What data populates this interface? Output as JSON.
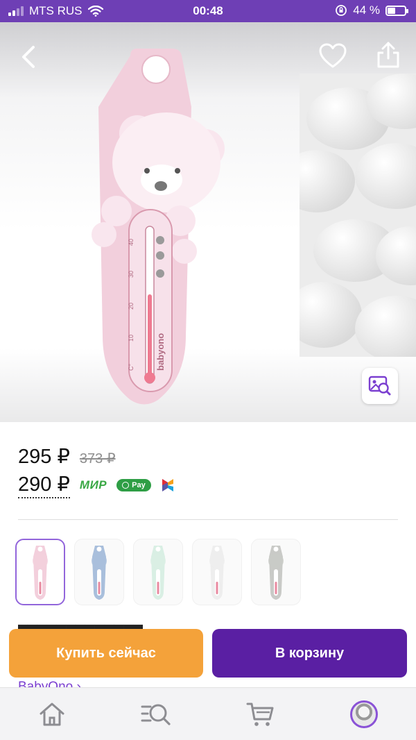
{
  "status_bar": {
    "carrier": "MTS RUS",
    "time": "00:48",
    "battery_percent": "44 %",
    "battery_level": 0.44
  },
  "gallery": {
    "icons": [
      "back-arrow-icon",
      "heart-icon",
      "share-icon",
      "image-search-icon"
    ],
    "product_print": {
      "scale_labels": [
        "40",
        "30",
        "20",
        "10",
        "C°"
      ],
      "brand": "babyono"
    }
  },
  "price": {
    "current": "295 ₽",
    "old": "373 ₽",
    "card_price": "290 ₽",
    "payment_badges": {
      "mir": "МИР",
      "sbp_pay": "Pay"
    }
  },
  "thumbnails": [
    {
      "variant": "pink bear",
      "selected": true,
      "color": "#f3cfdc"
    },
    {
      "variant": "blue koala",
      "selected": false,
      "color": "#a9bfdc"
    },
    {
      "variant": "mint",
      "selected": false,
      "color": "#d9efe4"
    },
    {
      "variant": "white panda",
      "selected": false,
      "color": "#eeeeee"
    },
    {
      "variant": "grey raccoon",
      "selected": false,
      "color": "#c9cac7"
    }
  ],
  "behind_text": {
    "brand_link": "BabyOno ›"
  },
  "actions": {
    "buy_now": "Купить сейчас",
    "add_to_cart": "В корзину"
  },
  "tab_bar": {
    "items": [
      "home-icon",
      "catalog-search-icon",
      "cart-icon",
      "profile-avatar"
    ]
  },
  "colors": {
    "brand_purple": "#5a1fa3",
    "status_bar": "#6e3fb5",
    "buy_now_orange": "#f4a23a",
    "accent_light_purple": "#9265db"
  }
}
